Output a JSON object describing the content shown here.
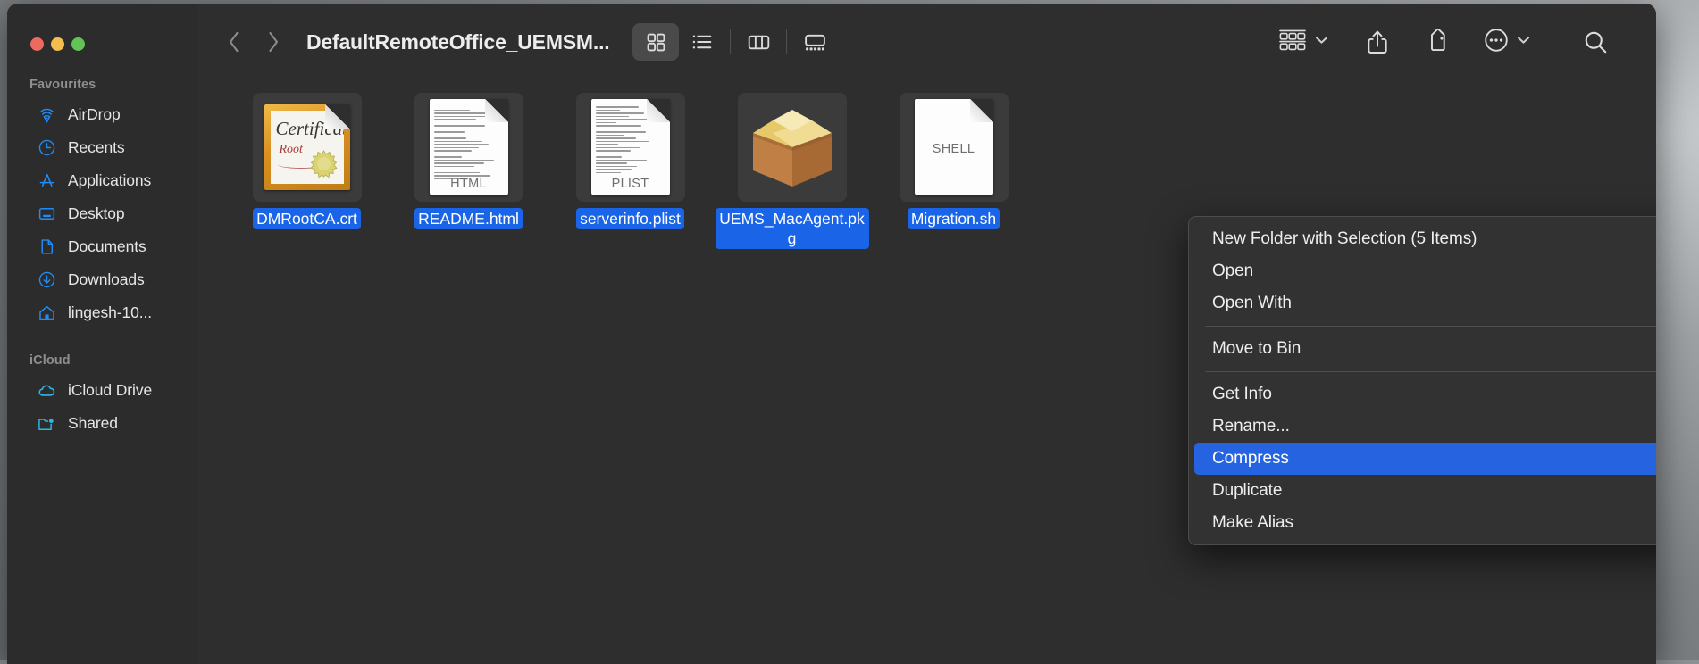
{
  "window": {
    "title": "DefaultRemoteOffice_UEMSM...",
    "traffic_lights": [
      {
        "name": "close",
        "color": "#ec6a5f"
      },
      {
        "name": "minimize",
        "color": "#f4be4f"
      },
      {
        "name": "maximize",
        "color": "#61c454"
      }
    ]
  },
  "sidebar": {
    "sections": [
      {
        "title": "Favourites",
        "items": [
          {
            "label": "AirDrop",
            "icon": "airdrop-icon"
          },
          {
            "label": "Recents",
            "icon": "clock-icon"
          },
          {
            "label": "Applications",
            "icon": "applications-icon"
          },
          {
            "label": "Desktop",
            "icon": "desktop-icon"
          },
          {
            "label": "Documents",
            "icon": "document-icon"
          },
          {
            "label": "Downloads",
            "icon": "download-icon"
          },
          {
            "label": "lingesh-10...",
            "icon": "home-icon"
          }
        ]
      },
      {
        "title": "iCloud",
        "items": [
          {
            "label": "iCloud Drive",
            "icon": "cloud-icon"
          },
          {
            "label": "Shared",
            "icon": "shared-folder-icon"
          }
        ]
      }
    ]
  },
  "toolbar": {
    "back": "back-icon",
    "forward": "forward-icon",
    "view_icon_label": "icon-view",
    "view_list_label": "list-view",
    "view_column_label": "column-view",
    "view_gallery_label": "gallery-view",
    "group_label": "group-by",
    "share_label": "share",
    "tag_label": "tag",
    "more_label": "more-actions",
    "search_label": "search",
    "active_view": "icon-view"
  },
  "files": [
    {
      "name": "DMRootCA.crt",
      "type": "certificate",
      "badge": "",
      "selected": true,
      "cert_title": "Certificate",
      "cert_sub": "Root"
    },
    {
      "name": "README.html",
      "type": "document",
      "badge": "HTML",
      "selected": true
    },
    {
      "name": "serverinfo.plist",
      "type": "document",
      "badge": "PLIST",
      "selected": true
    },
    {
      "name": "UEMS_MacAgent.pkg",
      "type": "package",
      "badge": "",
      "selected": true
    },
    {
      "name": "Migration.sh",
      "type": "document",
      "badge": "SHELL",
      "selected": true
    }
  ],
  "context_menu": {
    "items": [
      {
        "label": "New Folder with Selection (5 Items)",
        "highlighted": false,
        "submenu": false,
        "separator_after": false
      },
      {
        "label": "Open",
        "highlighted": false,
        "submenu": false,
        "separator_after": false
      },
      {
        "label": "Open With",
        "highlighted": false,
        "submenu": true,
        "separator_after": true
      },
      {
        "label": "Move to Bin",
        "highlighted": false,
        "submenu": false,
        "separator_after": true
      },
      {
        "label": "Get Info",
        "highlighted": false,
        "submenu": false,
        "separator_after": false
      },
      {
        "label": "Rename...",
        "highlighted": false,
        "submenu": false,
        "separator_after": false
      },
      {
        "label": "Compress",
        "highlighted": true,
        "submenu": false,
        "separator_after": false
      },
      {
        "label": "Duplicate",
        "highlighted": false,
        "submenu": false,
        "separator_after": false
      },
      {
        "label": "Make Alias",
        "highlighted": false,
        "submenu": false,
        "separator_after": false
      }
    ],
    "submenu_chevron": "›"
  },
  "colors": {
    "selection_blue": "#1a64e8",
    "menu_highlight": "#2563e0",
    "sidebar_bg": "#2c2c2c",
    "content_bg": "#2e2e2e",
    "menu_bg": "#323232",
    "accent_icon": "#1f8cf5",
    "icloud_icon": "#2bb8e6"
  }
}
